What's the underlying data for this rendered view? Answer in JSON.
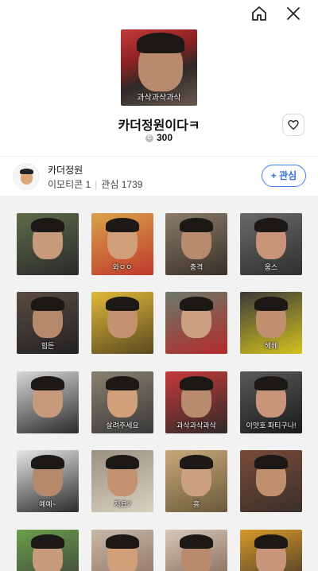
{
  "icons": {
    "home": "home-icon",
    "close": "close-icon",
    "heart": "heart-icon",
    "coin": "coin-icon"
  },
  "product": {
    "title": "카더정원이다ㅋ",
    "price": "300",
    "coin_symbol": "C",
    "cover_caption": "과삭과삭과삭"
  },
  "creator": {
    "name": "카더정원",
    "emoticon_count": "이모티콘 1",
    "interest": "관심 1739",
    "follow_label": "+ 관심"
  },
  "colors": {
    "accent": "#2f6fe0",
    "grid_bg": "#f2f2f2"
  },
  "emoticons": [
    {
      "caption": ""
    },
    {
      "caption": "와ㅇㅇ"
    },
    {
      "caption": "충격"
    },
    {
      "caption": "움스"
    },
    {
      "caption": "힘든"
    },
    {
      "caption": ""
    },
    {
      "caption": ""
    },
    {
      "caption": "헤헤"
    },
    {
      "caption": ""
    },
    {
      "caption": "살려주세요"
    },
    {
      "caption": "과삭과삭과삭"
    },
    {
      "caption": "이얏호 파티구나!"
    },
    {
      "caption": "예예~"
    },
    {
      "caption": "저요?"
    },
    {
      "caption": "흥"
    },
    {
      "caption": ""
    },
    {
      "caption": ""
    },
    {
      "caption": ""
    },
    {
      "caption": ""
    },
    {
      "caption": ""
    }
  ]
}
